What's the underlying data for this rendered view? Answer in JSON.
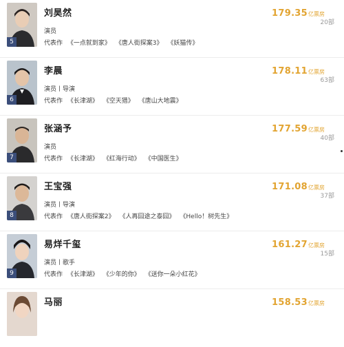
{
  "rows": [
    {
      "rank": "5",
      "name": "刘昊然",
      "role": "演员",
      "works_prefix": "代表作",
      "works": [
        "《一点就到家》",
        "《唐人街探案3》",
        "《妖猫传》"
      ],
      "box": "179.35",
      "unit": "亿票房",
      "count": "20部",
      "avatar_bg": "#cfc9c2"
    },
    {
      "rank": "6",
      "name": "李晨",
      "role": "演员丨导演",
      "works_prefix": "代表作",
      "works": [
        "《长津湖》",
        "《空天猎》",
        "《唐山大地震》"
      ],
      "box": "178.11",
      "unit": "亿票房",
      "count": "63部",
      "avatar_bg": "#b9c3cc"
    },
    {
      "rank": "7",
      "name": "张涵予",
      "role": "演员",
      "works_prefix": "代表作",
      "works": [
        "《长津湖》",
        "《红海行动》",
        "《中国医生》"
      ],
      "box": "177.59",
      "unit": "亿票房",
      "count": "40部",
      "avatar_bg": "#c8c4bd"
    },
    {
      "rank": "8",
      "name": "王宝强",
      "role": "演员丨导演",
      "works_prefix": "代表作",
      "works": [
        "《唐人街探案2》",
        "《人再囧途之泰囧》",
        "《Hello！树先生》"
      ],
      "box": "171.08",
      "unit": "亿票房",
      "count": "37部",
      "avatar_bg": "#d4d2cf"
    },
    {
      "rank": "9",
      "name": "易烊千玺",
      "role": "演员丨歌手",
      "works_prefix": "代表作",
      "works": [
        "《长津湖》",
        "《少年的你》",
        "《送你一朵小红花》"
      ],
      "box": "161.27",
      "unit": "亿票房",
      "count": "15部",
      "avatar_bg": "#c5cdd6"
    },
    {
      "rank": "",
      "name": "马丽",
      "role": "",
      "works_prefix": "",
      "works": [],
      "box": "158.53",
      "unit": "亿票房",
      "count": "",
      "avatar_bg": "#e4d8cf"
    }
  ]
}
